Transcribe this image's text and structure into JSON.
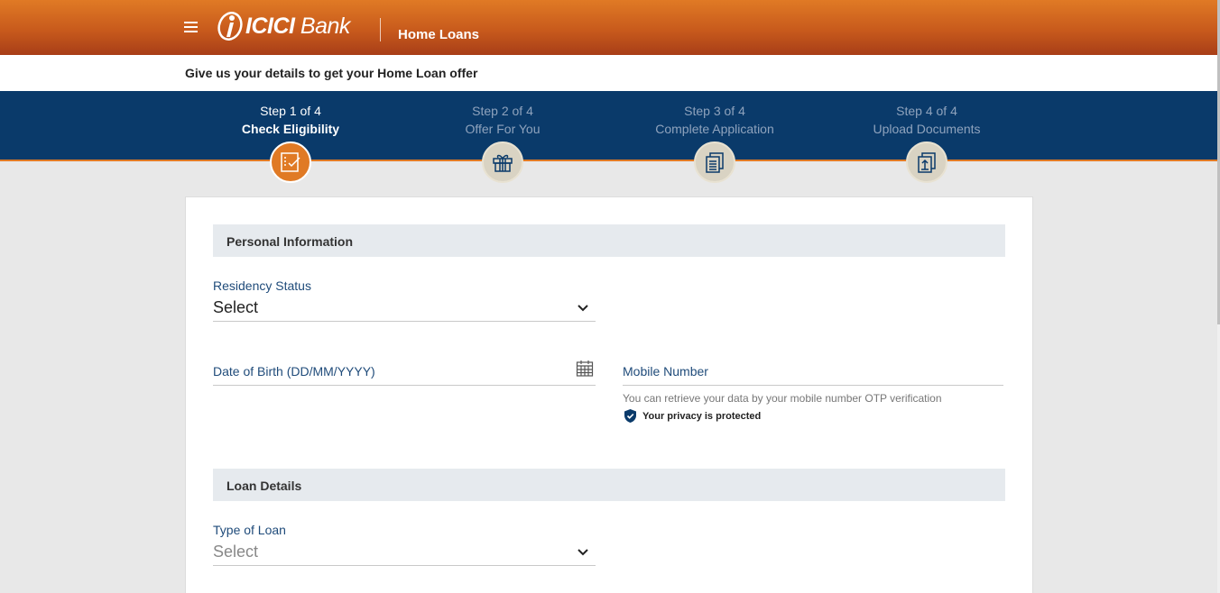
{
  "header": {
    "logo_text_bold": "ICICI",
    "logo_text_rest": " Bank",
    "product": "Home Loans",
    "brand_color": "#c85a1c"
  },
  "subbar": {
    "text": "Give us your details to get your Home Loan offer"
  },
  "steps": [
    {
      "num": "Step 1 of 4",
      "name": "Check Eligibility",
      "icon": "checklist-icon",
      "active": true
    },
    {
      "num": "Step 2 of 4",
      "name": "Offer For You",
      "icon": "gift-icon",
      "active": false
    },
    {
      "num": "Step 3 of 4",
      "name": "Complete Application",
      "icon": "documents-icon",
      "active": false
    },
    {
      "num": "Step 4 of 4",
      "name": "Upload Documents",
      "icon": "upload-document-icon",
      "active": false
    }
  ],
  "personal": {
    "title": "Personal Information",
    "residency_label": "Residency Status",
    "residency_value": "Select",
    "dob_label": "Date of Birth (DD/MM/YYYY)",
    "mobile_label": "Mobile Number",
    "mobile_hint": "You can retrieve your data by your mobile number OTP verification",
    "privacy_text": "Your privacy is protected"
  },
  "loan": {
    "title": "Loan Details",
    "type_label": "Type of Loan",
    "type_value": "Select"
  },
  "colors": {
    "accent": "#e07a25",
    "navy": "#0a3a6a",
    "label": "#1f4b7a"
  }
}
